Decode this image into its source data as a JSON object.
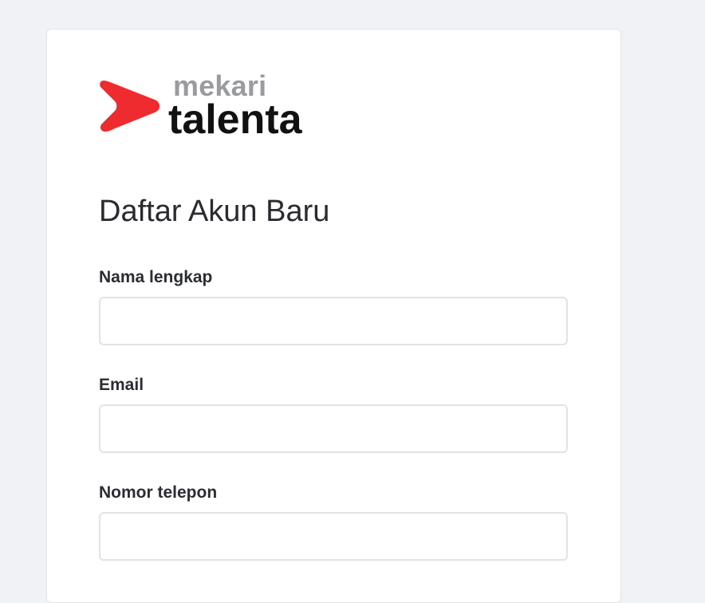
{
  "logo": {
    "brand": "mekari",
    "product": "talenta",
    "mark_color": "#ee2b2e"
  },
  "form": {
    "title": "Daftar Akun Baru",
    "fields": [
      {
        "label": "Nama lengkap",
        "value": "",
        "placeholder": ""
      },
      {
        "label": "Email",
        "value": "",
        "placeholder": ""
      },
      {
        "label": "Nomor telepon",
        "value": "",
        "placeholder": ""
      }
    ]
  }
}
